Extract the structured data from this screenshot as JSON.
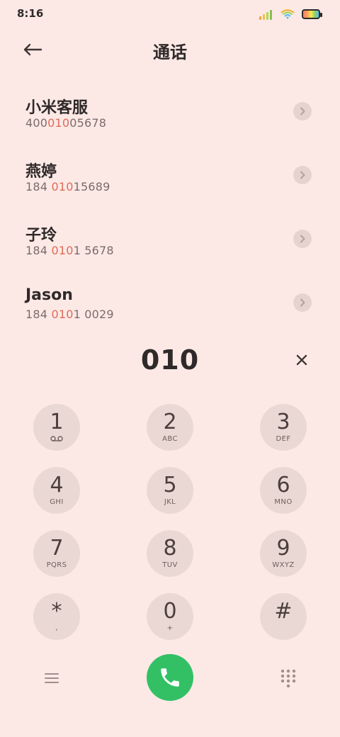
{
  "status": {
    "time": "8:16"
  },
  "header": {
    "title": "通话"
  },
  "contacts": [
    {
      "name": "小米客服",
      "number_parts": {
        "a": "400",
        "b": "010",
        "c": "05678"
      }
    },
    {
      "name": "燕婷",
      "number_parts": {
        "a": "184 ",
        "b": "010",
        "c": "15689"
      }
    },
    {
      "name": "子玲",
      "number_parts": {
        "a": "184 ",
        "b": "010",
        "c": "1 5678"
      }
    },
    {
      "name": "Jason",
      "number_parts": {
        "a": "184 ",
        "b": "010",
        "c": "1 0029"
      }
    }
  ],
  "dialer": {
    "number": "010"
  },
  "keypad": {
    "k1": {
      "digit": "1",
      "sub": ""
    },
    "k2": {
      "digit": "2",
      "sub": "ABC"
    },
    "k3": {
      "digit": "3",
      "sub": "DEF"
    },
    "k4": {
      "digit": "4",
      "sub": "GHI"
    },
    "k5": {
      "digit": "5",
      "sub": "JKL"
    },
    "k6": {
      "digit": "6",
      "sub": "MNO"
    },
    "k7": {
      "digit": "7",
      "sub": "PQRS"
    },
    "k8": {
      "digit": "8",
      "sub": "TUV"
    },
    "k9": {
      "digit": "9",
      "sub": "WXYZ"
    },
    "kstar": {
      "digit": "*",
      "sub": ","
    },
    "k0": {
      "digit": "0",
      "sub": "+"
    },
    "khash": {
      "digit": "#",
      "sub": ""
    }
  },
  "icons": {
    "back": "arrow-left-icon",
    "clear": "close-icon",
    "menu": "menu-icon",
    "call": "phone-icon",
    "keypad": "keypad-icon",
    "voicemail": "voicemail-icon",
    "chevron": "chevron-right-icon"
  },
  "colors": {
    "background": "#fce9e6",
    "accent": "#de6b57",
    "call_green": "#33c065"
  }
}
